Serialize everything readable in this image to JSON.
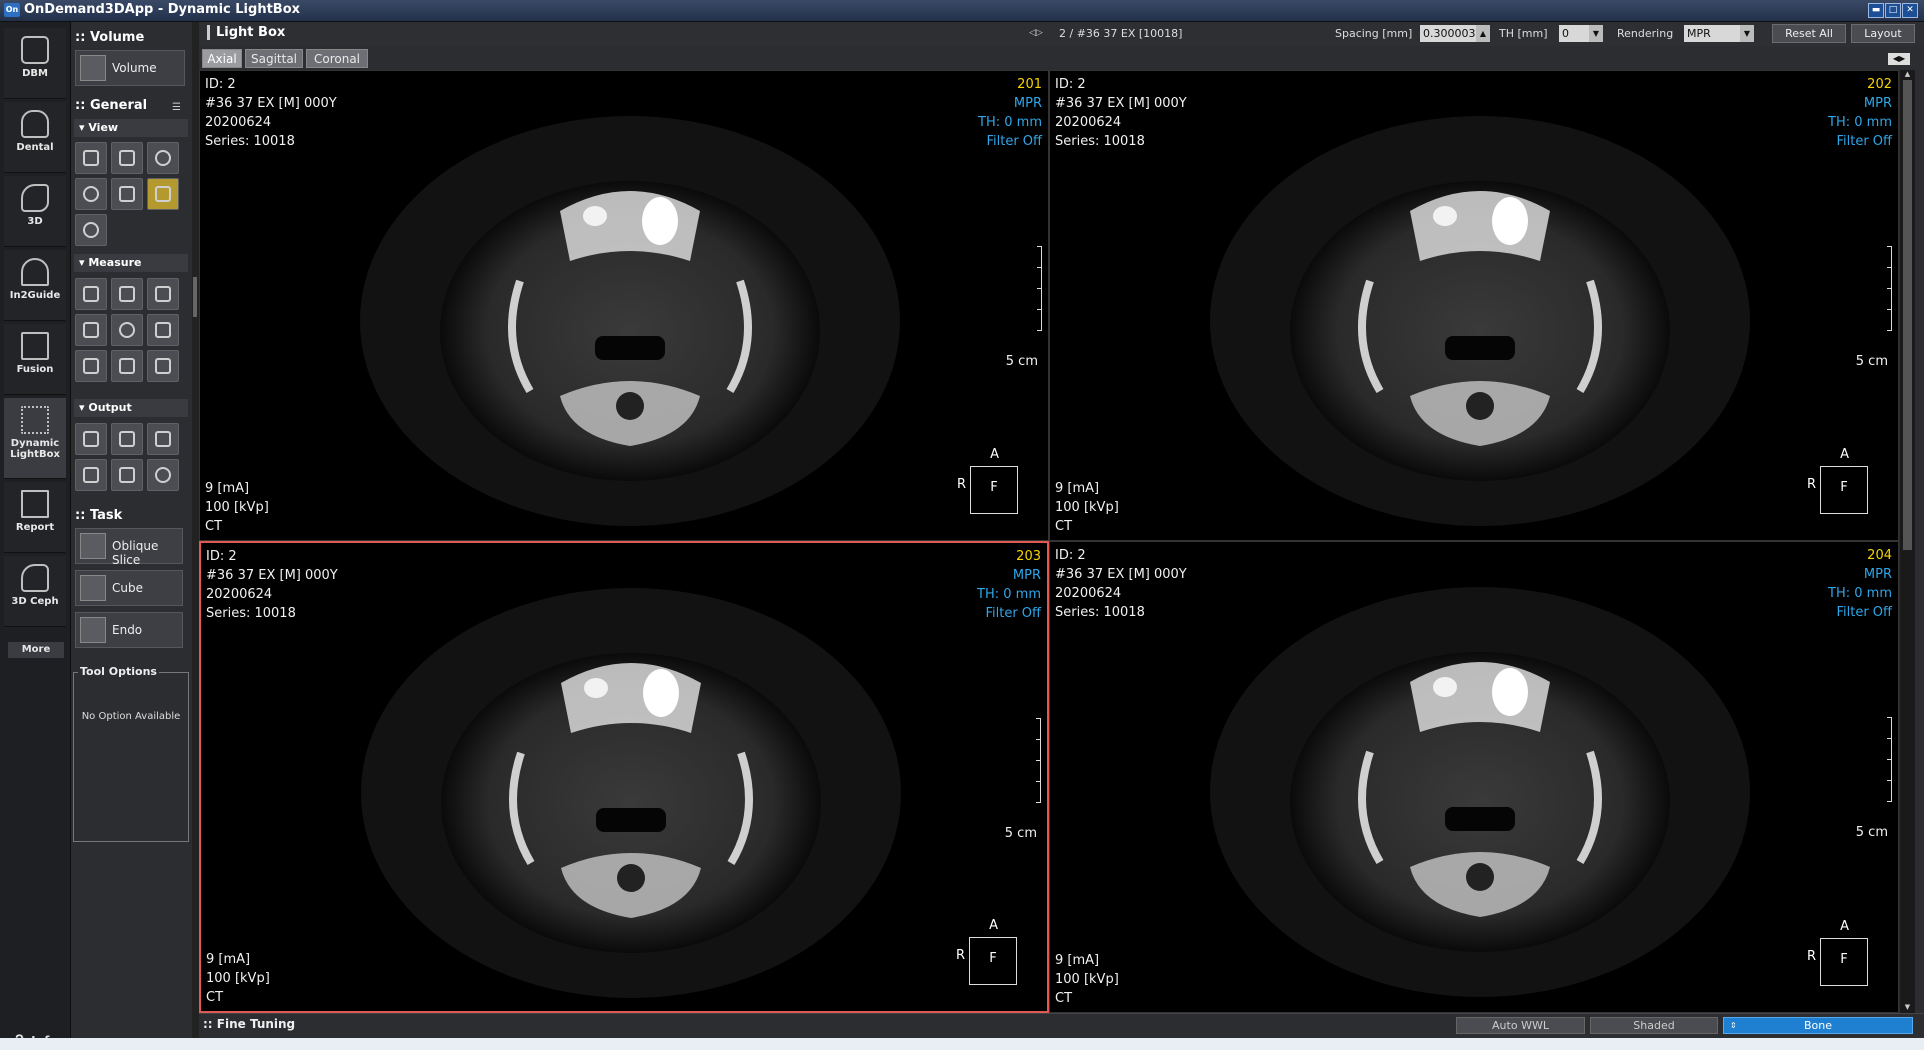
{
  "window": {
    "app_icon": "On",
    "title": "OnDemand3DApp - Dynamic LightBox",
    "controls": [
      "restore",
      "maximize",
      "close"
    ]
  },
  "rail": {
    "items": [
      {
        "label": "DBM",
        "icon": "database-icon"
      },
      {
        "label": "Dental",
        "icon": "tooth-icon"
      },
      {
        "label": "3D",
        "icon": "head-3d-icon"
      },
      {
        "label": "In2Guide",
        "icon": "jaw-icon"
      },
      {
        "label": "Fusion",
        "icon": "fusion-icon"
      },
      {
        "label": "Dynamic LightBox",
        "icon": "lightbox-icon"
      },
      {
        "label": "Report",
        "icon": "report-icon"
      },
      {
        "label": "3D Ceph",
        "icon": "ceph-icon"
      }
    ],
    "more": "More",
    "info": "Info."
  },
  "tools": {
    "volume_header": "Volume",
    "volume_button": "Volume",
    "general_header": "General",
    "view_header": "View",
    "measure_header": "Measure",
    "output_header": "Output",
    "task_header": "Task",
    "task_buttons": [
      "Oblique Slice",
      "Cube",
      "Endo"
    ],
    "tool_options_header": "Tool Options",
    "tool_options_text": "No Option Available"
  },
  "topbar": {
    "title": "Light Box",
    "navigation": "2 / #36 37 EX [10018]",
    "spacing_label": "Spacing [mm]",
    "spacing_value": "0.300003",
    "th_label": "TH [mm]",
    "th_value": "0",
    "rendering_label": "Rendering",
    "rendering_value": "MPR",
    "reset_all": "Reset All",
    "layout": "Layout"
  },
  "tabs": [
    "Axial",
    "Sagittal",
    "Coronal"
  ],
  "active_tab": "Axial",
  "viewports": [
    {
      "id": "ID: 2",
      "patient": "#36 37 EX [M] 000Y",
      "date": "20200624",
      "series": "Series: 10018",
      "slice": "201",
      "mode": "MPR",
      "th": "TH: 0 mm",
      "filter": "Filter Off",
      "ma": "9 [mA]",
      "kvp": "100 [kVp]",
      "modality": "CT",
      "scale": "5 cm",
      "orient_top": "A",
      "orient_left": "R",
      "orient_center": "F",
      "selected": false
    },
    {
      "id": "ID: 2",
      "patient": "#36 37 EX [M] 000Y",
      "date": "20200624",
      "series": "Series: 10018",
      "slice": "202",
      "mode": "MPR",
      "th": "TH: 0 mm",
      "filter": "Filter Off",
      "ma": "9 [mA]",
      "kvp": "100 [kVp]",
      "modality": "CT",
      "scale": "5 cm",
      "orient_top": "A",
      "orient_left": "R",
      "orient_center": "F",
      "selected": false
    },
    {
      "id": "ID: 2",
      "patient": "#36 37 EX [M] 000Y",
      "date": "20200624",
      "series": "Series: 10018",
      "slice": "203",
      "mode": "MPR",
      "th": "TH: 0 mm",
      "filter": "Filter Off",
      "ma": "9 [mA]",
      "kvp": "100 [kVp]",
      "modality": "CT",
      "scale": "5 cm",
      "orient_top": "A",
      "orient_left": "R",
      "orient_center": "F",
      "selected": true
    },
    {
      "id": "ID: 2",
      "patient": "#36 37 EX [M] 000Y",
      "date": "20200624",
      "series": "Series: 10018",
      "slice": "204",
      "mode": "MPR",
      "th": "TH: 0 mm",
      "filter": "Filter Off",
      "ma": "9 [mA]",
      "kvp": "100 [kVp]",
      "modality": "CT",
      "scale": "5 cm",
      "orient_top": "A",
      "orient_left": "R",
      "orient_center": "F",
      "selected": false
    }
  ],
  "bottombar": {
    "title": "Fine Tuning",
    "auto_wwl": "Auto WWL",
    "shaded": "Shaded",
    "bone": "Bone"
  },
  "colors": {
    "accent_blue": "#1f7fd0",
    "slice_number_yellow": "#f5d400",
    "overlay_cyan": "#2fa6e8",
    "selected_border_red": "#e05a55"
  }
}
